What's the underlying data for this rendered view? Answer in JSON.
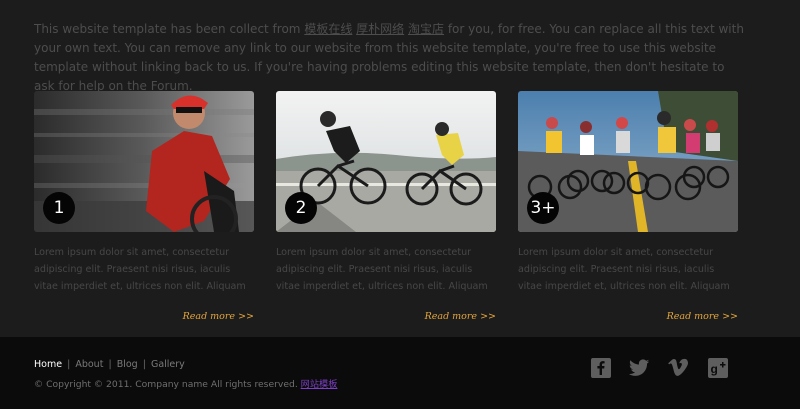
{
  "intro": {
    "text_before": "This website template has been collect from ",
    "link1": "模板在线",
    "link2": "厚朴网络",
    "link3": "淘宝店",
    "text_after": " for you, for free. You can replace all this text with your own text. You can remove any link to our website from this website template, you're free to use this website template without linking back to us. If you're having problems editing this website template, then don't hesitate to ask for help on the Forum."
  },
  "cards": [
    {
      "badge": "1",
      "text": "Lorem ipsum dolor sit amet, consectetur adipiscing elit. Praesent nisi risus, iaculis vitae imperdiet et, ultrices non elit. Aliquam est purus, tristique dictum",
      "link": "Read more >>"
    },
    {
      "badge": "2",
      "text": "Lorem ipsum dolor sit amet, consectetur adipiscing elit. Praesent nisi risus, iaculis vitae imperdiet et, ultrices non elit. Aliquam est purus, tristique dictum",
      "link": "Read more >>"
    },
    {
      "badge": "3+",
      "text": "Lorem ipsum dolor sit amet, consectetur adipiscing elit. Praesent nisi risus, iaculis vitae imperdiet et, ultrices non elit. Aliquam est purus, tristique dictum",
      "link": "Read more >>"
    }
  ],
  "footer": {
    "nav": [
      "Home",
      "About",
      "Blog",
      "Gallery"
    ],
    "separator": "|",
    "copyright": "© Copyright © 2011. Company name All rights reserved. ",
    "copyright_link": "网站模板",
    "social": [
      {
        "icon": "facebook-icon",
        "glyph": "f"
      },
      {
        "icon": "twitter-icon",
        "glyph": "t"
      },
      {
        "icon": "vimeo-icon",
        "glyph": "v"
      },
      {
        "icon": "google-plus-icon",
        "glyph": "g+"
      }
    ]
  },
  "colors": {
    "background": "#1c1c1c",
    "footer_background": "#0b0b0b",
    "body_text": "#4d4d4d",
    "read_more": "#e2a53b",
    "footer_link_active": "#ffffff",
    "copyright_link": "#7a3fc2"
  }
}
